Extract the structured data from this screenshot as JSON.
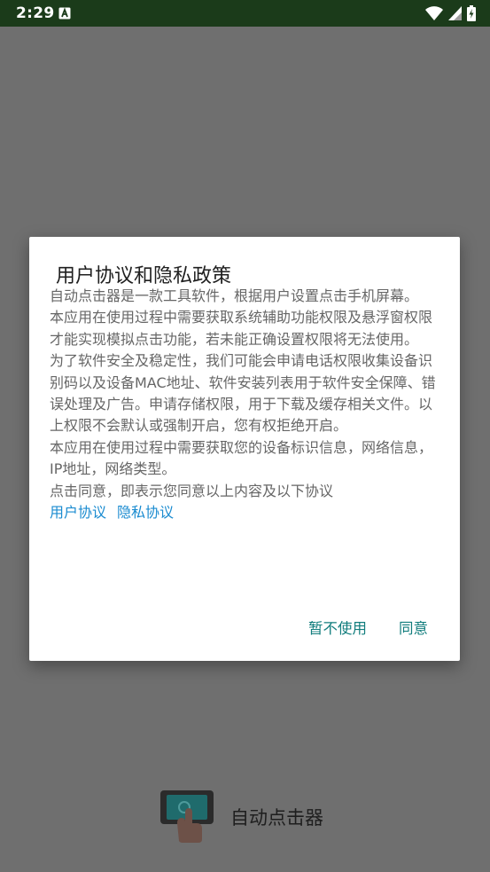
{
  "status_bar": {
    "time": "2:29"
  },
  "dialog": {
    "title": "用户协议和隐私政策",
    "paragraphs": [
      "自动点击器是一款工具软件，根据用户设置点击手机屏幕。",
      "本应用在使用过程中需要获取系统辅助功能权限及悬浮窗权限才能实现模拟点击功能，若未能正确设置权限将无法使用。",
      "为了软件安全及稳定性，我们可能会申请电话权限收集设备识别码以及设备MAC地址、软件安装列表用于软件安全保障、错误处理及广告。申请存储权限，用于下载及缓存相关文件。以上权限不会默认或强制开启，您有权拒绝开启。",
      "本应用在使用过程中需要获取您的设备标识信息，网络信息，IP地址，网络类型。",
      "点击同意，即表示您同意以上内容及以下协议"
    ],
    "links": {
      "user_agreement": "用户协议",
      "privacy_policy": "隐私协议"
    },
    "buttons": {
      "decline": "暂不使用",
      "agree": "同意"
    }
  },
  "app": {
    "name": "自动点击器"
  },
  "colors": {
    "status_bar_bg": "#1b3b1a",
    "scrim_bg": "#6f6f6f",
    "link": "#1a8bd0",
    "button_text": "#117d7d",
    "body_text": "#666666"
  },
  "icons": [
    "notification-a-icon",
    "wifi-icon",
    "cell-signal-icon",
    "battery-charging-icon",
    "app-logo-icon"
  ]
}
